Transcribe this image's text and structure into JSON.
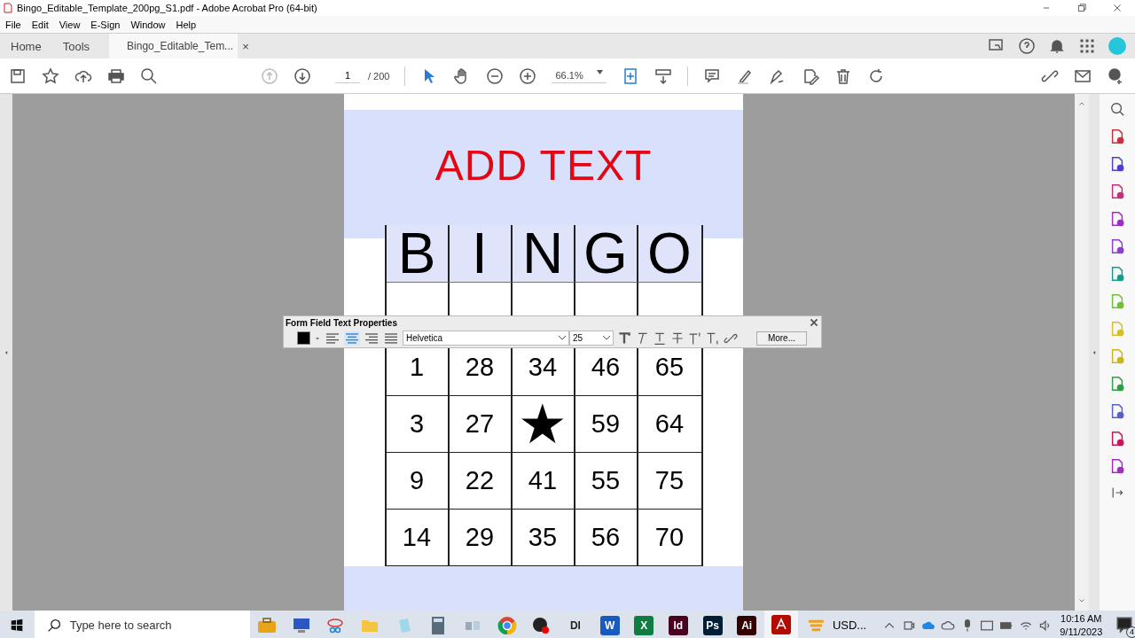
{
  "window": {
    "title": "Bingo_Editable_Template_200pg_S1.pdf - Adobe Acrobat Pro (64-bit)"
  },
  "menu": [
    "File",
    "Edit",
    "View",
    "E-Sign",
    "Window",
    "Help"
  ],
  "tabs": [
    {
      "label": "Home",
      "selected": false
    },
    {
      "label": "Tools",
      "selected": false
    },
    {
      "label": "Bingo_Editable_Tem...",
      "selected": true,
      "close": "×"
    }
  ],
  "toolbar": {
    "page": "1",
    "page_count": "/ 200",
    "zoom": "66.1%"
  },
  "document": {
    "heading": "ADD TEXT",
    "header": [
      "B",
      "I",
      "N",
      "G",
      "O"
    ],
    "rows": [
      [
        "1",
        "28",
        "34",
        "46",
        "65"
      ],
      [
        "3",
        "27",
        "★",
        "59",
        "64"
      ],
      [
        "9",
        "22",
        "41",
        "55",
        "75"
      ],
      [
        "14",
        "29",
        "35",
        "56",
        "70"
      ]
    ]
  },
  "field_toolbar": {
    "title": "Form Field Text Properties",
    "alignments": [
      {
        "kind": "left",
        "selected": false
      },
      {
        "kind": "center",
        "selected": true
      },
      {
        "kind": "right",
        "selected": false
      },
      {
        "kind": "justify",
        "selected": false
      }
    ],
    "font": "Helvetica",
    "size": "25",
    "more": "More..."
  },
  "tools": [
    {
      "color": "#c8313e"
    },
    {
      "color": "#4b3fd1"
    },
    {
      "color": "#c2307a"
    },
    {
      "color": "#9b2fc0"
    },
    {
      "color": "#8a3fd0"
    },
    {
      "color": "#1a9a8a"
    },
    {
      "color": "#6fbf3a"
    },
    {
      "color": "#d6c02a"
    },
    {
      "color": "#c9b51e"
    },
    {
      "color": "#2f9e44"
    },
    {
      "color": "#5a5fc7"
    },
    {
      "color": "#c2185b"
    },
    {
      "color": "#a02fc0"
    }
  ],
  "taskbar": {
    "search_placeholder": "Type here to search",
    "apps": [
      {
        "kind": "briefcase",
        "selected": false
      },
      {
        "kind": "monitor",
        "selected": false
      },
      {
        "kind": "snip",
        "selected": false
      },
      {
        "kind": "folder",
        "selected": false
      },
      {
        "kind": "notepad",
        "selected": false
      },
      {
        "kind": "calculator",
        "selected": false
      },
      {
        "kind": "tool",
        "selected": false
      },
      {
        "kind": "chrome",
        "selected": false
      },
      {
        "kind": "obs",
        "selected": false
      },
      {
        "kind": "tile",
        "label": "DI",
        "selected": false
      },
      {
        "kind": "tile",
        "label": "W",
        "color": "#185abd",
        "selected": false
      },
      {
        "kind": "tile",
        "label": "X",
        "color": "#107c41",
        "selected": false
      },
      {
        "kind": "tile",
        "label": "Id",
        "color": "#49021f",
        "selected": false
      },
      {
        "kind": "tile",
        "label": "Ps",
        "color": "#001e36",
        "selected": false
      },
      {
        "kind": "tile",
        "label": "Ai",
        "color": "#330000",
        "selected": false
      },
      {
        "kind": "acrobat",
        "selected": true
      }
    ],
    "weather": "USD...",
    "time": "10:16 AM",
    "date": "9/11/2023",
    "notifications": "4"
  }
}
